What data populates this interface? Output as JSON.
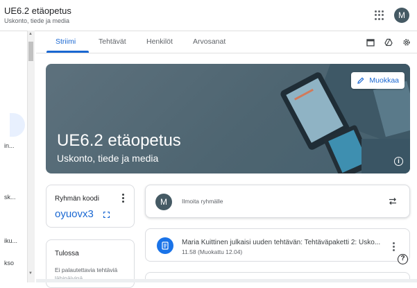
{
  "header": {
    "course_title": "UE6.2 etäopetus",
    "course_subtitle": "Uskonto, tiede ja media",
    "apps_icon": "apps-grid-icon",
    "avatar_letter": "M",
    "avatar_color": "#455a64"
  },
  "sidebar": {
    "items": [
      {
        "label": "in..."
      },
      {
        "label": "sk..."
      },
      {
        "label": "iku..."
      },
      {
        "label": "kso"
      }
    ]
  },
  "tabs": [
    {
      "label": "Striimi",
      "active": true
    },
    {
      "label": "Tehtävät",
      "active": false
    },
    {
      "label": "Henkilöt",
      "active": false
    },
    {
      "label": "Arvosanat",
      "active": false
    }
  ],
  "toolbar_icons": [
    "calendar-icon",
    "drive-icon",
    "settings-icon"
  ],
  "banner": {
    "title": "UE6.2 etäopetus",
    "subtitle": "Uskonto, tiede ja media",
    "edit_label": "Muokkaa",
    "info_icon": "info-icon"
  },
  "class_code": {
    "label": "Ryhmän koodi",
    "value": "oyuovx3"
  },
  "upcoming": {
    "title": "Tulossa",
    "text": "Ei palautettavia tehtäviä",
    "text2": "lähipäivinä"
  },
  "announce": {
    "avatar_letter": "M",
    "placeholder": "Ilmoita ryhmälle"
  },
  "posts": [
    {
      "title": "Maria Kuittinen julkaisi uuden tehtävän: Tehtäväpaketti 2: Usko...",
      "time": "11.58 (Muokattu 12.04)"
    }
  ],
  "colors": {
    "accent": "#1967d2",
    "banner": "#4e6571",
    "post_icon": "#1a73e8"
  }
}
